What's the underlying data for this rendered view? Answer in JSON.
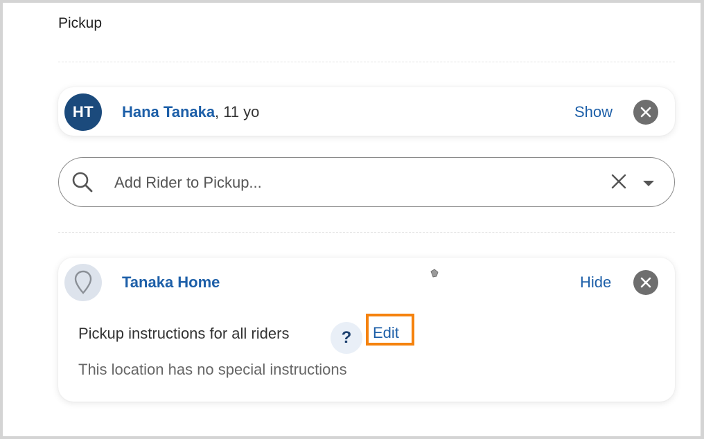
{
  "section": {
    "title": "Pickup"
  },
  "rider": {
    "initials": "HT",
    "name": "Hana Tanaka",
    "age_suffix": ", 11 yo",
    "toggle_label": "Show"
  },
  "search": {
    "placeholder": "Add Rider to Pickup..."
  },
  "location": {
    "name": "Tanaka Home",
    "toggle_label": "Hide",
    "instructions_label": "Pickup instructions for all riders",
    "help_glyph": "?",
    "edit_label": "Edit",
    "no_instructions": "This location has no special instructions"
  },
  "colors": {
    "accent": "#1d5fa8",
    "avatar_bg": "#1b4a7c",
    "highlight": "#f5820d",
    "close_bg": "#6e6e6e"
  }
}
